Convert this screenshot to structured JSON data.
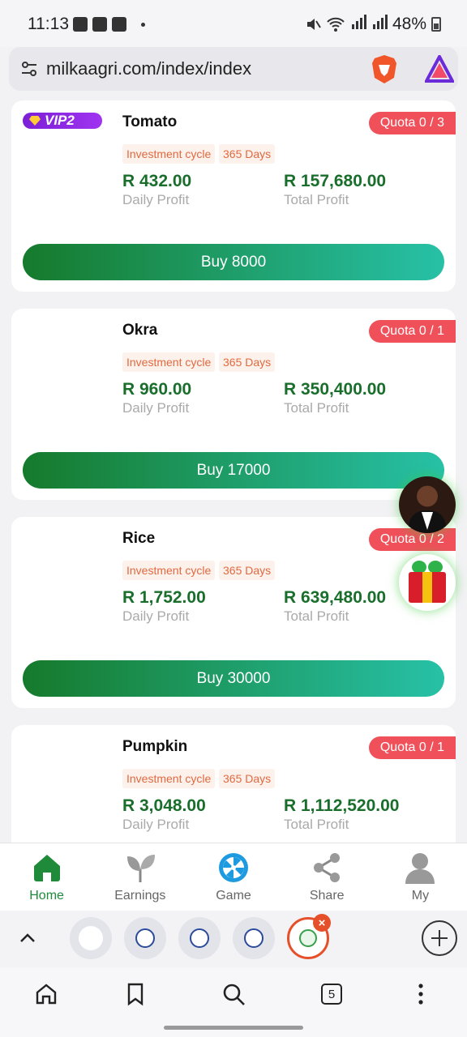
{
  "status_bar": {
    "time": "11:13",
    "battery": "48%"
  },
  "browser": {
    "url": "milkaagri.com/index/index",
    "tab_count": "5"
  },
  "products": [
    {
      "vip": "VIP2",
      "name": "Tomato",
      "quota": "Quota 0 / 3",
      "cycle_label": "Investment cycle",
      "cycle_days": "365 Days",
      "daily_profit": "R 432.00",
      "daily_label": "Daily Profit",
      "total_profit": "R 157,680.00",
      "total_label": "Total Profit",
      "buy_label": "Buy 8000"
    },
    {
      "name": "Okra",
      "quota": "Quota 0 / 1",
      "cycle_label": "Investment cycle",
      "cycle_days": "365 Days",
      "daily_profit": "R 960.00",
      "daily_label": "Daily Profit",
      "total_profit": "R 350,400.00",
      "total_label": "Total Profit",
      "buy_label": "Buy 17000"
    },
    {
      "name": "Rice",
      "quota": "Quota 0 / 2",
      "cycle_label": "Investment cycle",
      "cycle_days": "365 Days",
      "daily_profit": "R 1,752.00",
      "daily_label": "Daily Profit",
      "total_profit": "R 639,480.00",
      "total_label": "Total Profit",
      "buy_label": "Buy 30000"
    },
    {
      "name": "Pumpkin",
      "quota": "Quota 0 / 1",
      "cycle_label": "Investment cycle",
      "cycle_days": "365 Days",
      "daily_profit": "R 3,048.00",
      "daily_label": "Daily Profit",
      "total_profit": "R 1,112,520.00",
      "total_label": "Total Profit",
      "buy_label": ""
    }
  ],
  "nav": [
    {
      "label": "Home",
      "icon": "home-icon",
      "active": true
    },
    {
      "label": "Earnings",
      "icon": "plant-icon"
    },
    {
      "label": "Game",
      "icon": "wheel-icon"
    },
    {
      "label": "Share",
      "icon": "share-icon"
    },
    {
      "label": "My",
      "icon": "user-icon"
    }
  ],
  "colors": {
    "accent_green": "#1a6e2c",
    "quota_red": "#f0505a",
    "vip_purple": "#8a24e4",
    "button_gradient_start": "#167a2c",
    "button_gradient_end": "#27c1a7"
  }
}
